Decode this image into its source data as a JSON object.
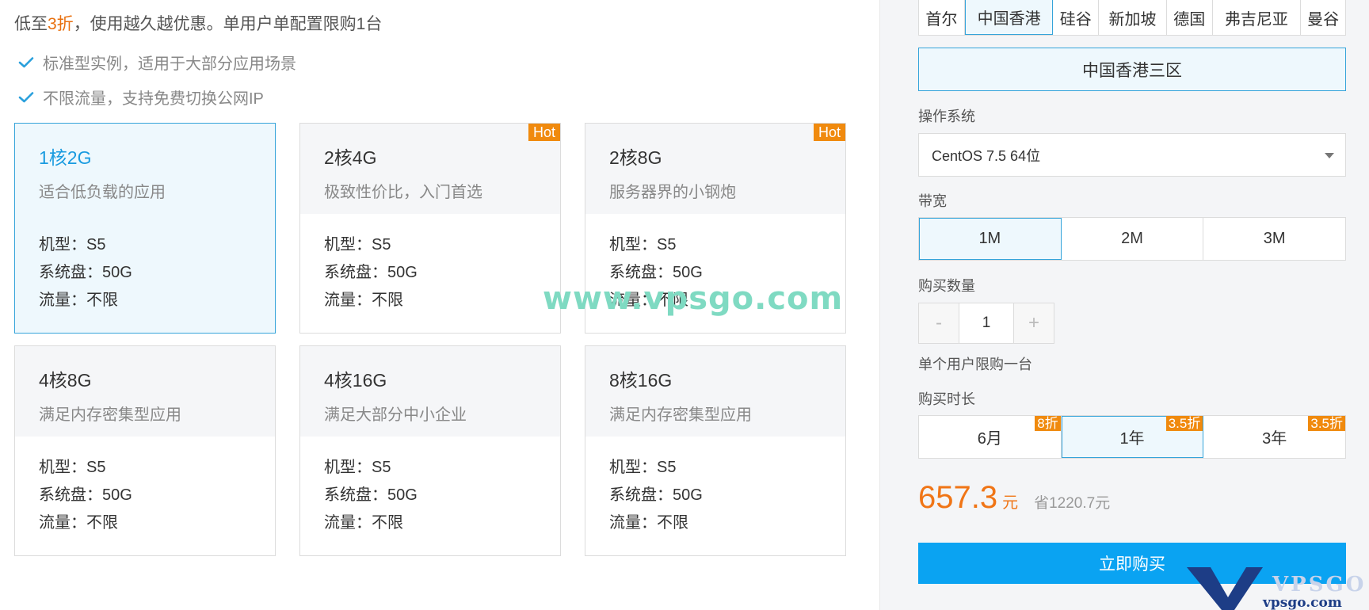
{
  "promo": {
    "prefix": "低至",
    "accent": "3折",
    "suffix": "，使用越久越优惠。单用户单配置限购1台"
  },
  "features": [
    {
      "text": "标准型实例，适用于大部分应用场景"
    },
    {
      "text": "不限流量，支持免费切换公网IP"
    }
  ],
  "spec_labels": {
    "model": "机型：",
    "disk": "系统盘：",
    "traffic": "流量："
  },
  "plans": [
    {
      "name": "1核2G",
      "desc": "适合低负载的应用",
      "model": "S5",
      "disk": "50G",
      "traffic": "不限",
      "hot": "",
      "selected": true
    },
    {
      "name": "2核4G",
      "desc": "极致性价比，入门首选",
      "model": "S5",
      "disk": "50G",
      "traffic": "不限",
      "hot": "Hot",
      "selected": false
    },
    {
      "name": "2核8G",
      "desc": "服务器界的小钢炮",
      "model": "S5",
      "disk": "50G",
      "traffic": "不限",
      "hot": "Hot",
      "selected": false
    },
    {
      "name": "4核8G",
      "desc": "满足内存密集型应用",
      "model": "S5",
      "disk": "50G",
      "traffic": "不限",
      "hot": "",
      "selected": false
    },
    {
      "name": "4核16G",
      "desc": "满足大部分中小企业",
      "model": "S5",
      "disk": "50G",
      "traffic": "不限",
      "hot": "",
      "selected": false
    },
    {
      "name": "8核16G",
      "desc": "满足内存密集型应用",
      "model": "S5",
      "disk": "50G",
      "traffic": "不限",
      "hot": "",
      "selected": false
    }
  ],
  "watermark": "www.vpsgo.com",
  "regions": {
    "items": [
      "首尔",
      "中国香港",
      "硅谷",
      "新加坡",
      "德国",
      "弗吉尼亚",
      "曼谷"
    ],
    "active": "中国香港"
  },
  "zone": "中国香港三区",
  "os": {
    "label": "操作系统",
    "value": "CentOS 7.5 64位"
  },
  "bandwidth": {
    "label": "带宽",
    "options": [
      "1M",
      "2M",
      "3M"
    ],
    "active": "1M"
  },
  "quantity": {
    "label": "购买数量",
    "minus": "-",
    "value": "1",
    "plus": "+",
    "limit_note": "单个用户限购一台"
  },
  "duration": {
    "label": "购买时长",
    "options": [
      {
        "label": "6月",
        "discount": "8折"
      },
      {
        "label": "1年",
        "discount": "3.5折"
      },
      {
        "label": "3年",
        "discount": "3.5折"
      }
    ],
    "active": "1年"
  },
  "price": {
    "amount": "657.3",
    "unit": "元",
    "save": "省1220.7元"
  },
  "buy_button": "立即购买",
  "logo": {
    "text": "VPSGO",
    "url_text": "vpsgo.com"
  },
  "colors": {
    "accent_blue": "#0aa3f2",
    "select_border": "#35a4da",
    "select_bg": "#eef8fd",
    "orange": "#f08a0e",
    "price_orange": "#f07516",
    "watermark": "#7fdac2"
  }
}
